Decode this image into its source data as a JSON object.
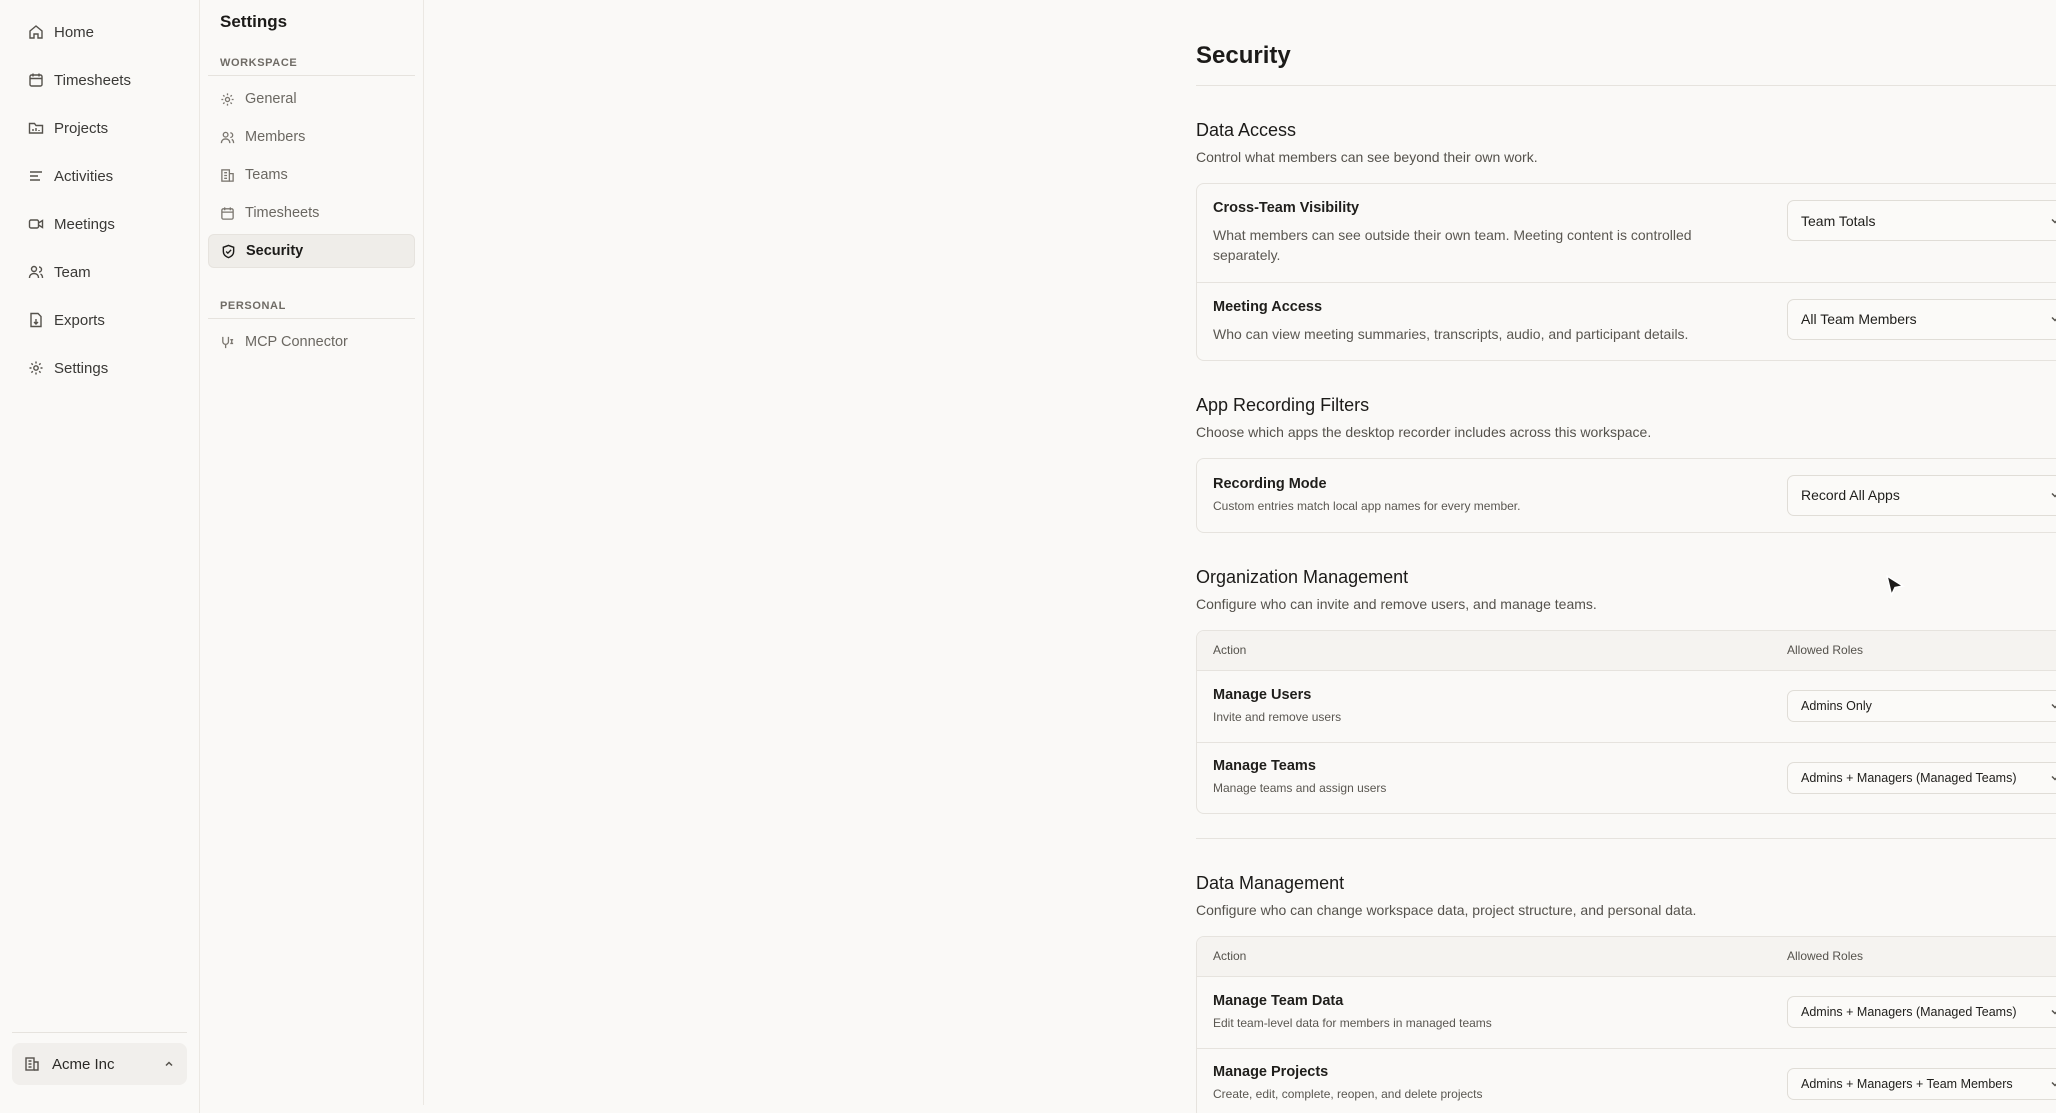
{
  "nav": {
    "items": [
      {
        "label": "Home",
        "icon": "home-icon"
      },
      {
        "label": "Timesheets",
        "icon": "calendar-icon"
      },
      {
        "label": "Projects",
        "icon": "folder-icon"
      },
      {
        "label": "Activities",
        "icon": "activity-icon"
      },
      {
        "label": "Meetings",
        "icon": "video-icon"
      },
      {
        "label": "Team",
        "icon": "users-icon"
      },
      {
        "label": "Exports",
        "icon": "file-export-icon"
      },
      {
        "label": "Settings",
        "icon": "gear-icon"
      }
    ],
    "org": "Acme Inc"
  },
  "settings_nav": {
    "title": "Settings",
    "workspace_label": "WORKSPACE",
    "workspace_items": [
      "General",
      "Members",
      "Teams",
      "Timesheets",
      "Security"
    ],
    "personal_label": "PERSONAL",
    "personal_items": [
      "MCP Connector"
    ],
    "active": "Security"
  },
  "page": {
    "title": "Security",
    "data_access": {
      "title": "Data Access",
      "desc": "Control what members can see beyond their own work.",
      "rows": [
        {
          "title": "Cross-Team Visibility",
          "desc": "What members can see outside their own team. Meeting content is controlled separately.",
          "value": "Team Totals"
        },
        {
          "title": "Meeting Access",
          "desc": "Who can view meeting summaries, transcripts, audio, and participant details.",
          "value": "All Team Members"
        }
      ]
    },
    "app_recording": {
      "title": "App Recording Filters",
      "desc": "Choose which apps the desktop recorder includes across this workspace.",
      "rows": [
        {
          "title": "Recording Mode",
          "desc": "Custom entries match local app names for every member.",
          "value": "Record All Apps"
        }
      ]
    },
    "org_mgmt": {
      "title": "Organization Management",
      "desc": "Configure who can invite and remove users, and manage teams.",
      "col_action": "Action",
      "col_roles": "Allowed Roles",
      "rows": [
        {
          "title": "Manage Users",
          "desc": "Invite and remove users",
          "value": "Admins Only"
        },
        {
          "title": "Manage Teams",
          "desc": "Manage teams and assign users",
          "value": "Admins + Managers (Managed Teams)"
        }
      ]
    },
    "data_mgmt": {
      "title": "Data Management",
      "desc": "Configure who can change workspace data, project structure, and personal data.",
      "col_action": "Action",
      "col_roles": "Allowed Roles",
      "rows": [
        {
          "title": "Manage Team Data",
          "desc": "Edit team-level data for members in managed teams",
          "value": "Admins + Managers (Managed Teams)"
        },
        {
          "title": "Manage Projects",
          "desc": "Create, edit, complete, reopen, and delete projects",
          "value": "Admins + Managers + Team Members"
        }
      ]
    }
  }
}
